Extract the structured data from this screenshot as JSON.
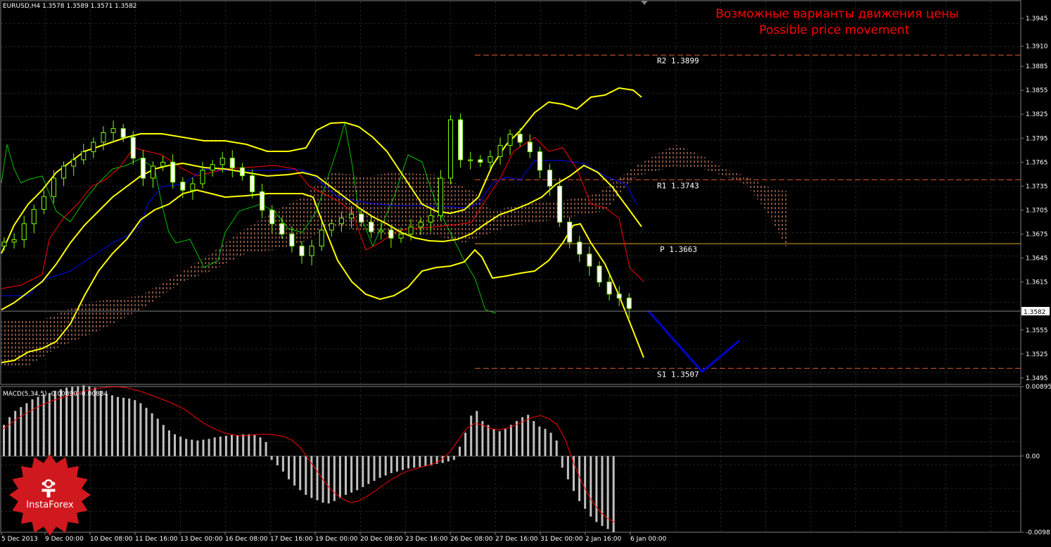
{
  "header": {
    "symbol_line": "EURUSD,H4  1.3578 1.3589 1.3571 1.3582"
  },
  "annotation": {
    "title_ru": "Возможные варианты движения цены",
    "title_en": "Possible price movement",
    "color": "#ff0000"
  },
  "macd_header": "MACD(5,34,5) -0.00890 -0.00834",
  "logo": {
    "text": "InstaForex",
    "color": "#d0181f"
  },
  "colors": {
    "background": "#000000",
    "grid": "#404040",
    "candle": "#7fff00",
    "bollinger": "#ffff00",
    "kumo": "#ffa07a",
    "kijun": "#0000ff",
    "tenkan": "#ff0000",
    "chikou": "#00c000",
    "forecast": "#0000cd",
    "pivot": "#daa520",
    "levels_dashed": "#e05a2b",
    "macd_hist": "#c0c0c0",
    "macd_signal": "#ff0000",
    "axis_text": "#ffffff"
  },
  "chart_data": [
    {
      "type": "candlestick",
      "symbol": "EURUSD",
      "timeframe": "H4",
      "last_price": "1.3582",
      "y_ticks": [
        "1.3945",
        "1.3910",
        "1.3885",
        "1.3855",
        "1.3825",
        "1.3795",
        "1.3765",
        "1.3735",
        "1.3705",
        "1.3675",
        "1.3645",
        "1.3615",
        "1.3582",
        "1.3555",
        "1.3525",
        "1.3495"
      ],
      "x_ticks": [
        "5 Dec 2013",
        "9 Dec 00:00",
        "10 Dec 08:00",
        "11 Dec 16:00",
        "13 Dec 00:00",
        "16 Dec 08:00",
        "17 Dec 16:00",
        "19 Dec 00:00",
        "20 Dec 08:00",
        "23 Dec 16:00",
        "26 Dec 08:00",
        "27 Dec 16:00",
        "31 Dec 00:00",
        "2 Jan 16:00",
        "6 Jan 00:00"
      ],
      "ylim": [
        1.3487,
        1.3967
      ],
      "levels": [
        {
          "label": "R2",
          "value": "1.3899",
          "style": "dashed"
        },
        {
          "label": "R1",
          "value": "1.3743",
          "style": "dashed"
        },
        {
          "label": "P",
          "value": "1.3663",
          "style": "solid"
        },
        {
          "label": "S1",
          "value": "1.3507",
          "style": "dashed"
        }
      ],
      "series": [
        {
          "kind": "close",
          "values": [
            1.3665,
            1.3668,
            1.3688,
            1.3706,
            1.3722,
            1.3745,
            1.376,
            1.3768,
            1.3778,
            1.379,
            1.3802,
            1.3807,
            1.3796,
            1.377,
            1.3745,
            1.376,
            1.3765,
            1.374,
            1.373,
            1.3738,
            1.3755,
            1.3762,
            1.377,
            1.3758,
            1.3748,
            1.3728,
            1.3705,
            1.3688,
            1.3675,
            1.366,
            1.3648,
            1.366,
            1.368,
            1.3688,
            1.3695,
            1.37,
            1.369,
            1.3678,
            1.368,
            1.367,
            1.3675,
            1.3684,
            1.369,
            1.3698,
            1.3745,
            1.3818,
            1.3768,
            1.3768,
            1.3765,
            1.3772,
            1.3786,
            1.38,
            1.379,
            1.3778,
            1.3755,
            1.3735,
            1.369,
            1.3665,
            1.365,
            1.3635,
            1.3615,
            1.36,
            1.3595,
            1.3582
          ]
        },
        {
          "kind": "bollinger_upper",
          "values": [
            1.3745,
            1.3775,
            1.379,
            1.38,
            1.3808,
            1.3808,
            1.38,
            1.3795,
            1.3792,
            1.38,
            1.3815,
            1.3812,
            1.3798,
            1.377,
            1.373,
            1.37,
            1.368,
            1.3685,
            1.371,
            1.374,
            1.376,
            1.3785,
            1.381,
            1.3835,
            1.3845,
            1.3855,
            1.3865,
            1.386,
            1.3855,
            1.37
          ]
        },
        {
          "kind": "bollinger_lower",
          "values": [
            1.359,
            1.364,
            1.3675,
            1.3705,
            1.3725,
            1.373,
            1.373,
            1.3722,
            1.3705,
            1.368,
            1.365,
            1.362,
            1.361,
            1.361,
            1.3625,
            1.364,
            1.3665,
            1.3665,
            1.3665,
            1.363,
            1.363,
            1.364,
            1.366,
            1.369,
            1.37,
            1.368,
            1.363,
            1.358,
            1.355,
            1.3525
          ]
        }
      ],
      "forecast": {
        "label": "Possible price movement",
        "points": [
          [
            0,
            1.3582
          ],
          [
            1,
            1.3505
          ],
          [
            2,
            1.3545
          ]
        ]
      }
    },
    {
      "type": "bar",
      "title": "MACD(5,34,5)",
      "values_text": {
        "main": "-0.00890",
        "signal": "-0.00834"
      },
      "y_ticks": [
        "0.00895",
        "0.00",
        "-0.00981"
      ],
      "ylim": [
        -0.00981,
        0.00895
      ],
      "histogram": [
        0.004,
        0.005,
        0.0058,
        0.0063,
        0.0068,
        0.0073,
        0.0076,
        0.0079,
        0.0081,
        0.0084,
        0.0086,
        0.0088,
        0.0089,
        0.009,
        0.0091,
        0.009,
        0.0088,
        0.0084,
        0.008,
        0.0078,
        0.0076,
        0.0075,
        0.0074,
        0.0072,
        0.0068,
        0.0062,
        0.0055,
        0.0048,
        0.004,
        0.0033,
        0.0028,
        0.0025,
        0.0022,
        0.0021,
        0.002,
        0.0021,
        0.0022,
        0.0024,
        0.0025,
        0.0026,
        0.0027,
        0.0027,
        0.0028,
        0.0028,
        0.0027,
        0.0024,
        0.0018,
        -0.0005,
        -0.0012,
        -0.002,
        -0.003,
        -0.0038,
        -0.0044,
        -0.005,
        -0.0054,
        -0.0057,
        -0.006,
        -0.0061,
        -0.0058,
        -0.0054,
        -0.005,
        -0.0047,
        -0.0044,
        -0.004,
        -0.0036,
        -0.0032,
        -0.0028,
        -0.0025,
        -0.0022,
        -0.002,
        -0.0018,
        -0.0016,
        -0.0015,
        -0.0014,
        -0.0013,
        -0.0012,
        -0.001,
        -0.0009,
        -0.0007,
        -0.0005,
        0.0012,
        0.003,
        0.0052,
        0.0058,
        0.0045,
        0.004,
        0.0035,
        0.0032,
        0.0035,
        0.004,
        0.0045,
        0.005,
        0.0053,
        0.0045,
        0.0038,
        0.0035,
        0.003,
        0.002,
        -0.0015,
        -0.003,
        -0.0045,
        -0.0058,
        -0.0068,
        -0.0078,
        -0.0085,
        -0.009,
        -0.0094,
        -0.0098
      ],
      "signal": [
        0.0035,
        0.0042,
        0.005,
        0.0056,
        0.0062,
        0.0067,
        0.0071,
        0.0075,
        0.0078,
        0.0081,
        0.0084,
        0.0086,
        0.0088,
        0.0089,
        0.0089,
        0.0088,
        0.0085,
        0.0082,
        0.0078,
        0.0074,
        0.007,
        0.0065,
        0.006,
        0.0052,
        0.0044,
        0.0038,
        0.0033,
        0.0029,
        0.0027,
        0.0026,
        0.0027,
        0.0028,
        0.0028,
        0.0027,
        0.0025,
        0.002,
        0.001,
        -0.0005,
        -0.002,
        -0.0035,
        -0.0047,
        -0.0055,
        -0.006,
        -0.0058,
        -0.0052,
        -0.0045,
        -0.0037,
        -0.003,
        -0.0024,
        -0.0019,
        -0.0016,
        -0.0013,
        -0.001,
        -0.0005,
        0.0005,
        0.002,
        0.0035,
        0.0042,
        0.004,
        0.0035,
        0.0034,
        0.0036,
        0.004,
        0.0045,
        0.005,
        0.0052,
        0.0048,
        0.004,
        0.002,
        -0.001,
        -0.0035,
        -0.0055,
        -0.007,
        -0.008,
        -0.0086
      ]
    }
  ]
}
